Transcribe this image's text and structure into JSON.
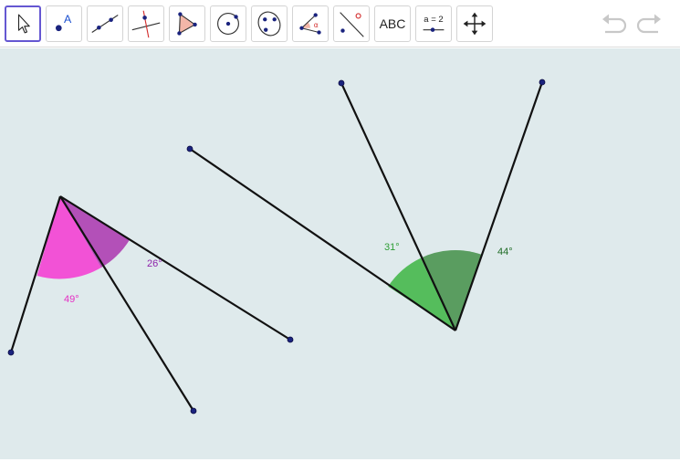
{
  "toolbar": {
    "tools": [
      {
        "name": "Move",
        "icon": "move-arrow-icon",
        "active": true
      },
      {
        "name": "Point",
        "icon": "point-icon",
        "point_label": "A"
      },
      {
        "name": "Segment",
        "icon": "segment-icon"
      },
      {
        "name": "Perpendicular Line",
        "icon": "perpendicular-line-icon"
      },
      {
        "name": "Polygon",
        "icon": "polygon-icon"
      },
      {
        "name": "Circle with Center through Point",
        "icon": "circle-icon"
      },
      {
        "name": "Ellipse",
        "icon": "ellipse-icon"
      },
      {
        "name": "Angle",
        "icon": "angle-icon",
        "angle_symbol": "α"
      },
      {
        "name": "Reflect about Line",
        "icon": "reflect-icon"
      },
      {
        "name": "Text",
        "icon": "text-icon",
        "text": "ABC"
      },
      {
        "name": "Slider",
        "icon": "slider-icon",
        "text": "a = 2"
      },
      {
        "name": "Move Graphics View",
        "icon": "move-graphics-icon"
      }
    ],
    "undo_icon": "undo-icon",
    "redo_icon": "redo-icon"
  },
  "colors": {
    "canvas_bg": "#dfeaec",
    "accent": "#6557d2",
    "point": "#1a237e",
    "magenta_angle": "#e52ec4",
    "purple_angle": "#8e24aa",
    "light_green_angle": "#43b54b",
    "dark_green_angle": "#2e7d32"
  },
  "angles": {
    "left_large": {
      "value": 49,
      "label": "49°"
    },
    "left_small": {
      "value": 26,
      "label": "26°"
    },
    "right_a": {
      "value": 31,
      "label": "31°"
    },
    "right_b": {
      "value": 44,
      "label": "44°"
    }
  }
}
